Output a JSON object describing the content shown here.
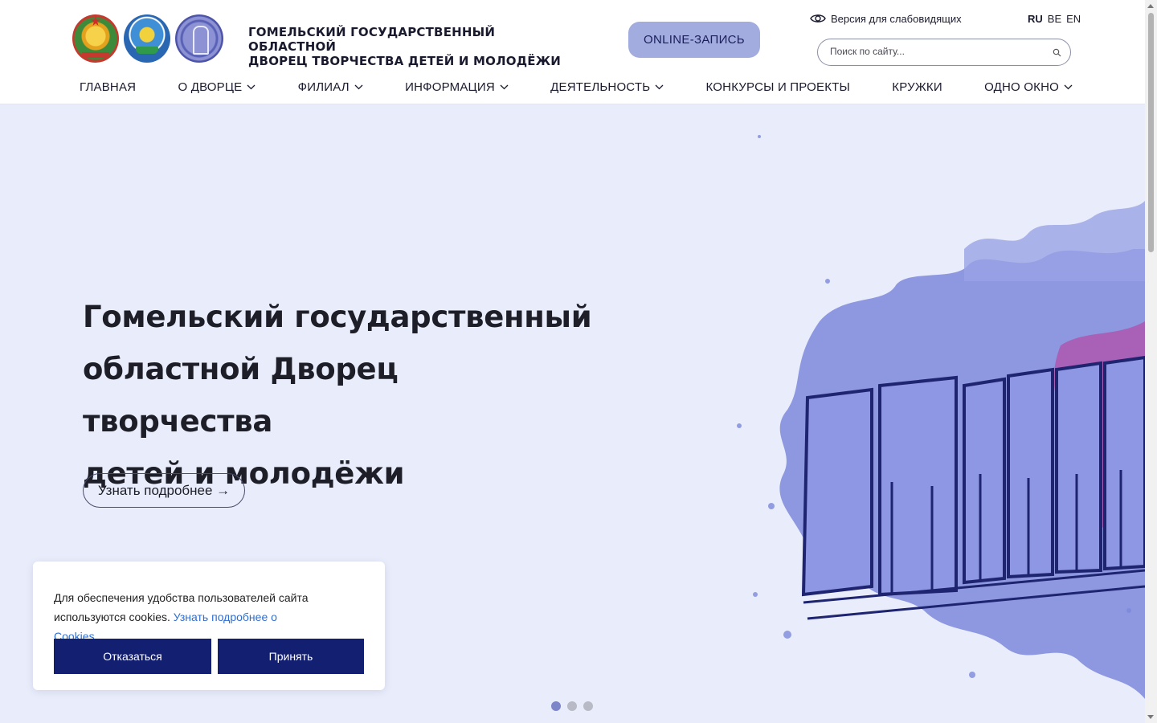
{
  "header": {
    "logos": [
      "coat-of-arms-icon",
      "ministry-emblem-icon",
      "palace-emblem-icon"
    ],
    "title_line1": "ГОМЕЛЬСКИЙ ГОСУДАРСТВЕННЫЙ ОБЛАСТНОЙ",
    "title_line2": "ДВОРЕЦ ТВОРЧЕСТВА ДЕТЕЙ И МОЛОДЁЖИ",
    "online_button": "ONLINE-ЗАПИСЬ",
    "vision_label": "Версия для слабовидящих",
    "languages": [
      "RU",
      "BE",
      "EN"
    ],
    "active_language": "RU",
    "search_placeholder": "Поиск по сайту..."
  },
  "nav": {
    "items": [
      {
        "label": "ГЛАВНАЯ",
        "dropdown": false
      },
      {
        "label": "О ДВОРЦЕ",
        "dropdown": true
      },
      {
        "label": "ФИЛИАЛ",
        "dropdown": true
      },
      {
        "label": "ИНФОРМАЦИЯ",
        "dropdown": true
      },
      {
        "label": "ДЕЯТЕЛЬНОСТЬ",
        "dropdown": true
      },
      {
        "label": "КОНКУРСЫ И ПРОЕКТЫ",
        "dropdown": false
      },
      {
        "label": "КРУЖКИ",
        "dropdown": false
      },
      {
        "label": "ОДНО ОКНО",
        "dropdown": true
      }
    ]
  },
  "hero": {
    "title_line1": "Гомельский государственный",
    "title_line2": "областной Дворец творчества",
    "title_line3": "детей и молодёжи",
    "button_label": "Узнать подробнее →",
    "slides_count": 3,
    "active_slide": 1
  },
  "cookie": {
    "text": "Для обеспечения удобства пользователей сайта используются cookies.",
    "link": "Узнать подробнее о Cookies",
    "decline": "Отказаться",
    "accept": "Принять"
  },
  "colors": {
    "accent": "#131f70",
    "online_button_bg": "#a3acdf",
    "hero_bg": "#e9edfb",
    "active_dot": "#7d86c9",
    "link": "#2f6ed1"
  }
}
